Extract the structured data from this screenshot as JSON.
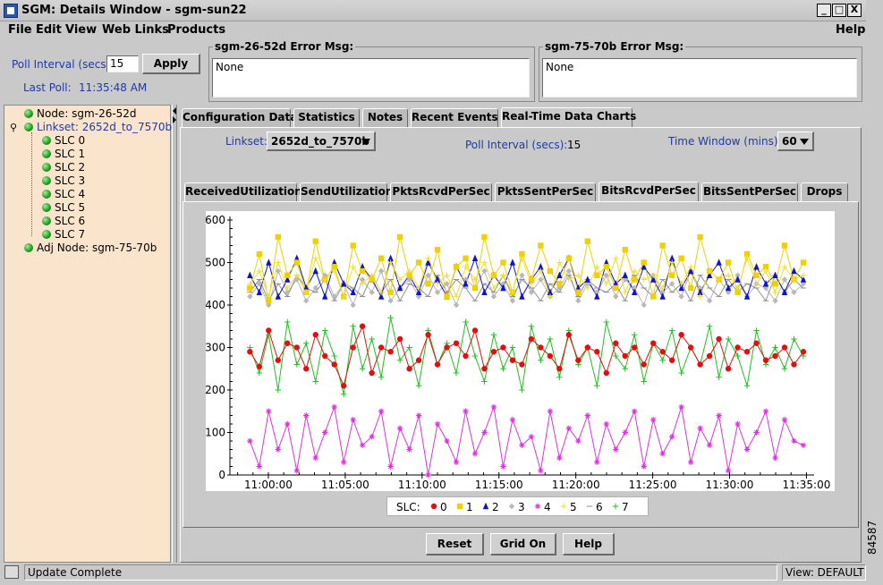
{
  "window": {
    "title": "SGM: Details Window - sgm-sun22",
    "min": "_",
    "max": "□",
    "close": "X"
  },
  "menu": [
    "File",
    "Edit",
    "View",
    "Web Links",
    "Products",
    "Help"
  ],
  "poll": {
    "label": "Poll Interval (secs)",
    "value": "15",
    "apply": "Apply",
    "last_poll_label": "Last Poll:",
    "last_poll_time": "11:35:48 AM"
  },
  "errors": [
    {
      "title": "sgm-26-52d  Error Msg:",
      "text": "None"
    },
    {
      "title": "sgm-75-70b  Error Msg:",
      "text": "None"
    }
  ],
  "tree": {
    "node": "Node: sgm-26-52d",
    "linkset": "Linkset: 2652d_to_7570b",
    "slcs": [
      "SLC 0",
      "SLC 1",
      "SLC 2",
      "SLC 3",
      "SLC 4",
      "SLC 5",
      "SLC 6",
      "SLC 7"
    ],
    "adj": "Adj Node: sgm-75-70b"
  },
  "tabs": [
    "Configuration Data",
    "Statistics",
    "Notes",
    "Recent Events",
    "Real-Time Data Charts"
  ],
  "controls": {
    "linkset_label": "Linkset:",
    "linkset_value": "2652d_to_7570b",
    "poll_label": "Poll Interval (secs):",
    "poll_value": "15",
    "window_label": "Time Window (mins):",
    "window_value": "60"
  },
  "subtabs": [
    "ReceivedUtilization",
    "SendUtilization",
    "PktsRcvdPerSec",
    "PktsSentPerSec",
    "BitsRcvdPerSec",
    "BitsSentPerSec",
    "Drops"
  ],
  "buttons": {
    "reset": "Reset",
    "grid": "Grid On",
    "help": "Help"
  },
  "status": {
    "text": "Update Complete",
    "view": "View: DEFAULT"
  },
  "side_text": "84587",
  "colors": {
    "slc0": "#e01010",
    "slc1": "#f0d000",
    "slc2": "#1010d0",
    "slc3": "#b8b8b8",
    "slc4": "#e030e0",
    "slc5": "#f0e030",
    "slc6": "#909090",
    "slc7": "#20c020"
  },
  "chart_data": {
    "type": "line",
    "xlabel": "",
    "ylabel": "",
    "ylim": [
      0,
      600
    ],
    "yticks": [
      "600",
      "500",
      "400",
      "300",
      "200",
      "100",
      "0"
    ],
    "xticks": [
      "11:00:00",
      "11:05:00",
      "11:10:00",
      "11:15:00",
      "11:20:00",
      "11:25:00",
      "11:30:00",
      "11:35:00"
    ],
    "legend_title": "SLC:",
    "legend_placement": "bottom",
    "x_start": "10:57:30",
    "x_end": "11:35:30",
    "series": [
      {
        "name": "0",
        "color": "#e01010",
        "marker": "circle",
        "values": [
          290,
          255,
          340,
          270,
          310,
          300,
          250,
          330,
          280,
          260,
          210,
          300,
          350,
          240,
          300,
          290,
          320,
          250,
          270,
          330,
          260,
          300,
          310,
          280,
          340,
          250,
          290,
          300,
          270,
          260,
          320,
          300,
          280,
          250,
          330,
          270,
          300,
          290,
          240,
          310,
          280,
          300,
          260,
          310,
          290,
          270,
          330,
          300,
          260,
          280,
          320,
          250,
          300,
          290,
          310,
          270,
          280,
          300,
          260,
          290
        ]
      },
      {
        "name": "1",
        "color": "#f0d000",
        "marker": "square",
        "values": [
          440,
          520,
          410,
          560,
          470,
          500,
          430,
          550,
          460,
          490,
          420,
          540,
          480,
          460,
          510,
          430,
          560,
          470,
          500,
          450,
          530,
          420,
          490,
          510,
          440,
          560,
          470,
          500,
          430,
          520,
          460,
          540,
          480,
          450,
          510,
          430,
          550,
          470,
          490,
          440,
          530,
          460,
          500,
          420,
          540,
          470,
          510,
          440,
          560,
          480,
          460,
          500,
          430,
          520,
          470,
          490,
          450,
          540,
          460,
          500
        ]
      },
      {
        "name": "2",
        "color": "#1010d0",
        "marker": "triangle",
        "values": [
          470,
          430,
          500,
          420,
          460,
          510,
          440,
          480,
          420,
          500,
          450,
          430,
          490,
          460,
          420,
          510,
          440,
          470,
          430,
          500,
          460,
          420,
          490,
          450,
          510,
          430,
          470,
          440,
          500,
          420,
          460,
          490,
          430,
          470,
          510,
          440,
          460,
          420,
          500,
          450,
          470,
          430,
          490,
          460,
          420,
          510,
          440,
          480,
          430,
          470,
          500,
          440,
          460,
          420,
          490,
          450,
          470,
          430,
          480,
          460
        ]
      },
      {
        "name": "3",
        "color": "#b8b8b8",
        "marker": "diamond",
        "values": [
          420,
          450,
          400,
          480,
          430,
          460,
          410,
          440,
          470,
          420,
          450,
          400,
          460,
          430,
          480,
          410,
          440,
          460,
          420,
          470,
          430,
          450,
          400,
          460,
          440,
          480,
          420,
          450,
          410,
          470,
          430,
          460,
          420,
          440,
          480,
          410,
          450,
          430,
          470,
          420,
          460,
          440,
          400,
          470,
          430,
          450,
          420,
          480,
          440,
          410,
          460,
          430,
          470,
          420,
          450,
          440,
          410,
          460,
          430,
          450
        ]
      },
      {
        "name": "4",
        "color": "#e030e0",
        "marker": "asterisk",
        "values": [
          80,
          20,
          150,
          60,
          120,
          10,
          140,
          40,
          100,
          160,
          30,
          130,
          70,
          90,
          150,
          20,
          110,
          60,
          140,
          0,
          120,
          80,
          30,
          150,
          50,
          100,
          160,
          20,
          130,
          70,
          90,
          10,
          150,
          40,
          110,
          80,
          140,
          30,
          120,
          60,
          100,
          150,
          20,
          130,
          50,
          90,
          160,
          30,
          110,
          70,
          140,
          10,
          120,
          60,
          100,
          150,
          40,
          130,
          80,
          70
        ]
      },
      {
        "name": "5",
        "color": "#f0e030",
        "marker": "plus",
        "values": [
          450,
          480,
          420,
          500,
          440,
          470,
          430,
          510,
          460,
          480,
          420,
          490,
          450,
          470,
          430,
          500,
          460,
          480,
          440,
          510,
          450,
          470,
          420,
          490,
          460,
          500,
          440,
          470,
          430,
          510,
          450,
          480,
          420,
          500,
          460,
          470,
          440,
          490,
          450,
          510,
          430,
          480,
          460,
          470,
          440,
          500,
          450,
          490,
          420,
          480,
          460,
          470,
          440,
          510,
          450,
          480,
          430,
          490,
          460,
          470
        ]
      },
      {
        "name": "6",
        "color": "#909090",
        "marker": "dash",
        "values": [
          430,
          460,
          410,
          450,
          420,
          470,
          440,
          430,
          460,
          410,
          450,
          440,
          420,
          470,
          430,
          460,
          410,
          450,
          440,
          420,
          470,
          430,
          460,
          440,
          410,
          450,
          430,
          470,
          420,
          460,
          440,
          410,
          450,
          430,
          470,
          420,
          460,
          440,
          430,
          450,
          410,
          470,
          440,
          420,
          460,
          430,
          450,
          410,
          470,
          440,
          420,
          460,
          430,
          450,
          440,
          410,
          470,
          430,
          460,
          440
        ]
      },
      {
        "name": "7",
        "color": "#20c020",
        "marker": "plus",
        "values": [
          300,
          240,
          330,
          200,
          360,
          260,
          310,
          220,
          340,
          280,
          190,
          350,
          250,
          320,
          230,
          370,
          270,
          300,
          210,
          340,
          260,
          310,
          240,
          360,
          280,
          220,
          330,
          250,
          300,
          200,
          350,
          270,
          320,
          230,
          340,
          260,
          300,
          210,
          360,
          280,
          250,
          330,
          220,
          310,
          270,
          340,
          240,
          300,
          260,
          350,
          230,
          320,
          280,
          210,
          340,
          260,
          300,
          250,
          320,
          280
        ]
      }
    ]
  }
}
